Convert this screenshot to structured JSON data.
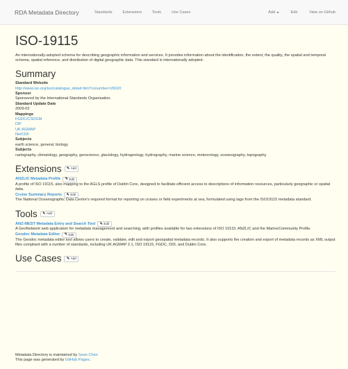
{
  "navbar": {
    "brand": "RDA Metadata Directory",
    "left_links": [
      "Standards",
      "Extensions",
      "Tools",
      "Use Cases"
    ],
    "add_label": "Add",
    "edit_label": "Edit",
    "github_label": "View on Github"
  },
  "page": {
    "title": "ISO-19115",
    "description": "An internationally-adopted schema for describing geographic information and services. It provides information about the identification, the extent, the quality, the spatial and temporal schema, spatial reference, and distribution of digital geographic data. This standard is internationally adopted."
  },
  "summary": {
    "heading": "Summary",
    "website_label": "Standard Website",
    "website_url": "http://www.iso.org/iso/catalogue_detail.htm?csnumber=26020",
    "sponsor_label": "Sponsor",
    "sponsor_value": "Sponsored by the International Standards Organisation.",
    "update_label": "Standard Update Date",
    "update_value": "2009-02",
    "mappings_label": "Mappings",
    "mappings": [
      "FGDC/CSDGM",
      "DIF",
      "UK AGMAP",
      "NetCDF"
    ],
    "subjects_label": "Subjects",
    "subjects_line1": "earth science, general, biology",
    "subjects2_label": "Subjects",
    "subjects_line2": "cartography, climatology, geography, geoscience, glaciology, hydrogeology, hydrography, marine science, meteorology, oceanography, topography"
  },
  "extensions": {
    "heading": "Extensions",
    "add_label": "Add",
    "items": [
      {
        "title": "ANZLIC Metadata Profile",
        "edit_label": "Edit",
        "desc": "A profile of ISO 19115, also mapping to the AGLS profile of Dublin Core, designed to facilitate efficient access to descriptions of information resources, particularly geographic or spatial data."
      },
      {
        "title": "Cruise Summary Reports",
        "edit_label": "Edit",
        "desc": "The National Oceanographic Data Centre's required format for reporting on cruises or field experiments at sea, formulated using tags from the ISO19115 metadata standard."
      }
    ]
  },
  "tools": {
    "heading": "Tools",
    "add_label": "Add",
    "items": [
      {
        "title": "ANZ-MEST Metadata Entry and Search Tool",
        "edit_label": "Edit",
        "desc": "A GeoNetwork web application for metadata management and searching, with profiles available for two extensions of ISO 19115: ANZLIC and the MarineCommunity Profile."
      },
      {
        "title": "Geodoc Metadata Editor",
        "edit_label": "Edit",
        "desc": "The Geodoc metadata editor tool allows users to create, validate, edit and export geospatial metadata records. It also supports the creation and export of metadata records as XML output files compliant with a number of standards, including UK AGMAP 2.1, ISO 19115, FGDC, DDI, and Dublin Core."
      }
    ]
  },
  "use_cases": {
    "heading": "Use Cases",
    "add_label": "Add"
  },
  "footer": {
    "line1_prefix": "Metadata Directory is maintained by ",
    "line1_link": "Sean Chen",
    "line2_prefix": "This page was generated by ",
    "line2_link": "GitHub Pages",
    "line2_suffix": "."
  },
  "icons": {
    "edit": "edit-icon",
    "caret": "caret-down-icon"
  },
  "colors": {
    "link": "#3a8fd6",
    "navbar_bg": "#f8f8f8",
    "page_bg": "#fffef0"
  }
}
